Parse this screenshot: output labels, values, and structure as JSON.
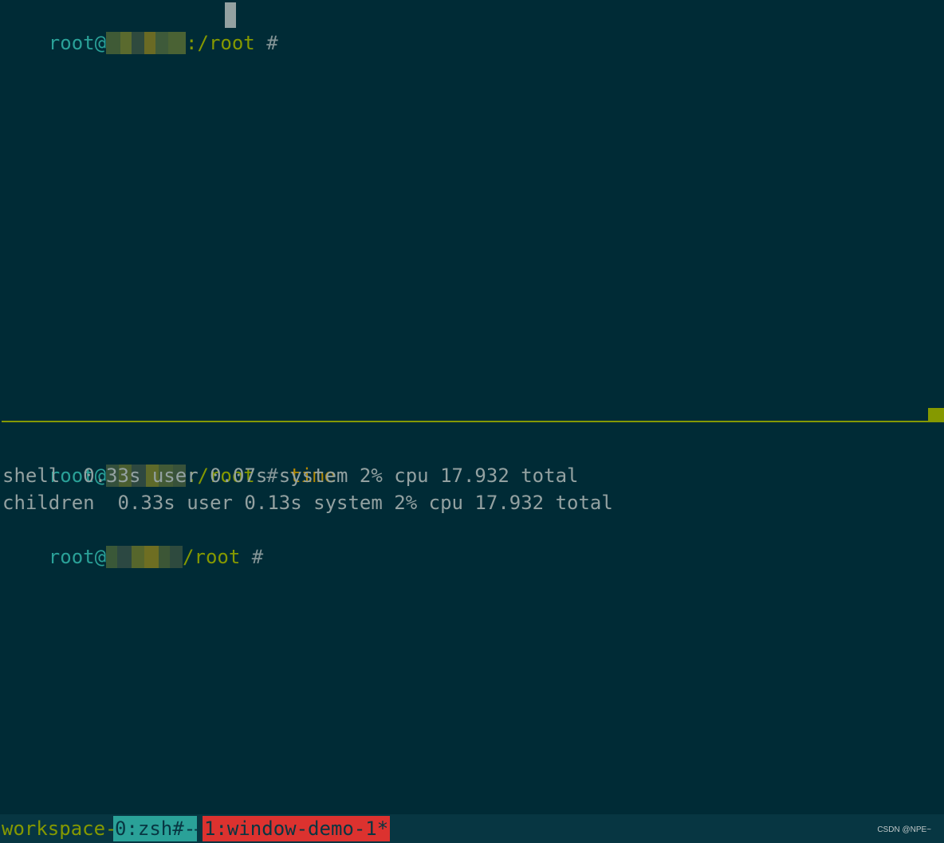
{
  "colors": {
    "background": "#002b36",
    "status_background": "#073642",
    "prompt_user": "#2aa198",
    "prompt_path": "#859900",
    "command": "#b58900",
    "output": "#93a1a1",
    "pane_border": "#859900",
    "window_current": "#2aa198",
    "window_other": "#dc322f"
  },
  "top_pane": {
    "prompt": {
      "user": "root@",
      "path": ":/root",
      "symbol": " # "
    }
  },
  "bottom_pane": {
    "lines": [
      {
        "kind": "prompt",
        "user": "root@",
        "path": ":/root",
        "symbol": " # ",
        "command": "time"
      },
      {
        "kind": "output",
        "text": "shell  0.33s user 0.07s system 2% cpu 17.932 total"
      },
      {
        "kind": "output",
        "text": "children  0.33s user 0.13s system 2% cpu 17.932 total"
      },
      {
        "kind": "prompt",
        "user": "root@",
        "path": "/root",
        "symbol": " # ",
        "command": ""
      }
    ]
  },
  "status_bar": {
    "session": "workspace-",
    "windows": [
      {
        "label": "0:zsh#-"
      },
      {
        "separator": "-"
      },
      {
        "label": "1:window-demo-1*"
      }
    ]
  },
  "watermark": "CSDN @NPE~"
}
